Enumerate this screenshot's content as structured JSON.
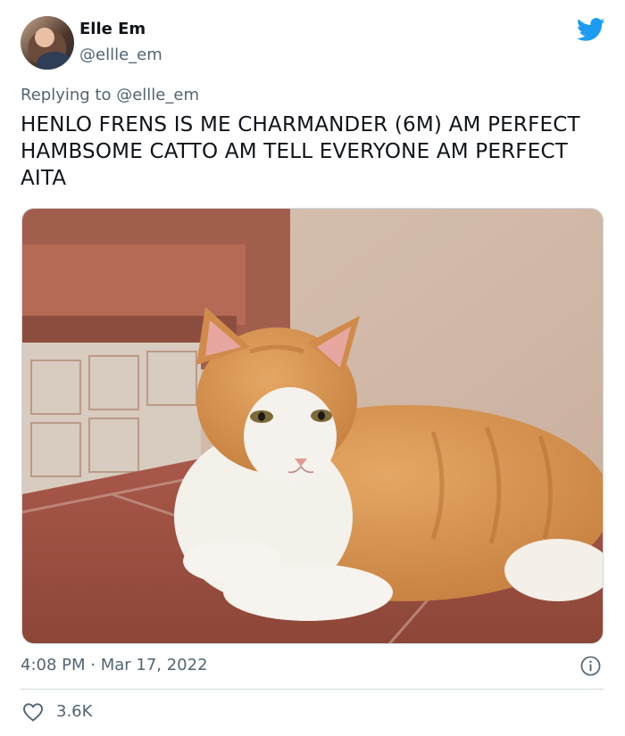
{
  "author": {
    "display_name": "Elle Em",
    "handle": "@ellle_em"
  },
  "reply": {
    "prefix": "Replying to",
    "mention": "@ellle_em"
  },
  "tweet": {
    "text": "HENLO FRENS IS ME CHARMANDER (6M) AM PERFECT HAMBSOME CATTO AM TELL EVERYONE AM PERFECT AITA",
    "timestamp": "4:08 PM · Mar 17, 2022",
    "likes": "3.6K"
  },
  "colors": {
    "twitter_blue": "#1d9bf0",
    "secondary_text": "#536471",
    "primary_text": "#0f1419"
  },
  "icons": {
    "brand": "twitter-bird-icon",
    "info": "info-icon",
    "like": "heart-icon"
  }
}
